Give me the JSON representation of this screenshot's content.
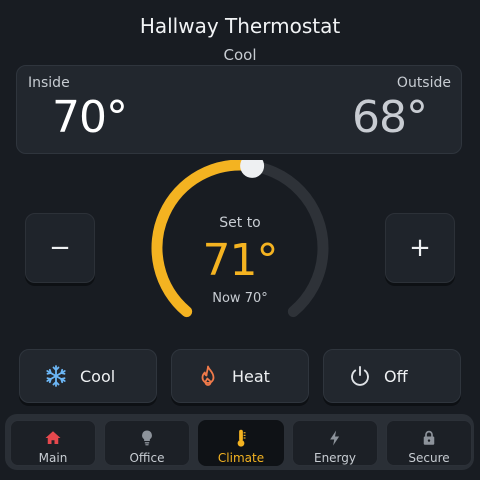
{
  "header": {
    "title": "Hallway Thermostat",
    "mode": "Cool"
  },
  "temperatures": {
    "inside_label": "Inside",
    "inside_value": "70°",
    "outside_label": "Outside",
    "outside_value": "68°"
  },
  "dial": {
    "set_label": "Set to",
    "setpoint": "71°",
    "now_label": "Now 70°",
    "setpoint_level": 0.53,
    "accent_color": "#f4b321",
    "track_color": "#2e3238"
  },
  "controls": {
    "decrease_label": "−",
    "increase_label": "+"
  },
  "modes": [
    {
      "label": "Cool",
      "icon": "snowflake-icon"
    },
    {
      "label": "Heat",
      "icon": "flame-icon"
    },
    {
      "label": "Off",
      "icon": "power-icon"
    }
  ],
  "nav": {
    "active": "Climate",
    "tabs": [
      {
        "label": "Main",
        "icon": "home-icon"
      },
      {
        "label": "Office",
        "icon": "lightbulb-icon"
      },
      {
        "label": "Climate",
        "icon": "thermometer-icon"
      },
      {
        "label": "Energy",
        "icon": "bolt-icon"
      },
      {
        "label": "Secure",
        "icon": "lock-icon"
      }
    ]
  }
}
